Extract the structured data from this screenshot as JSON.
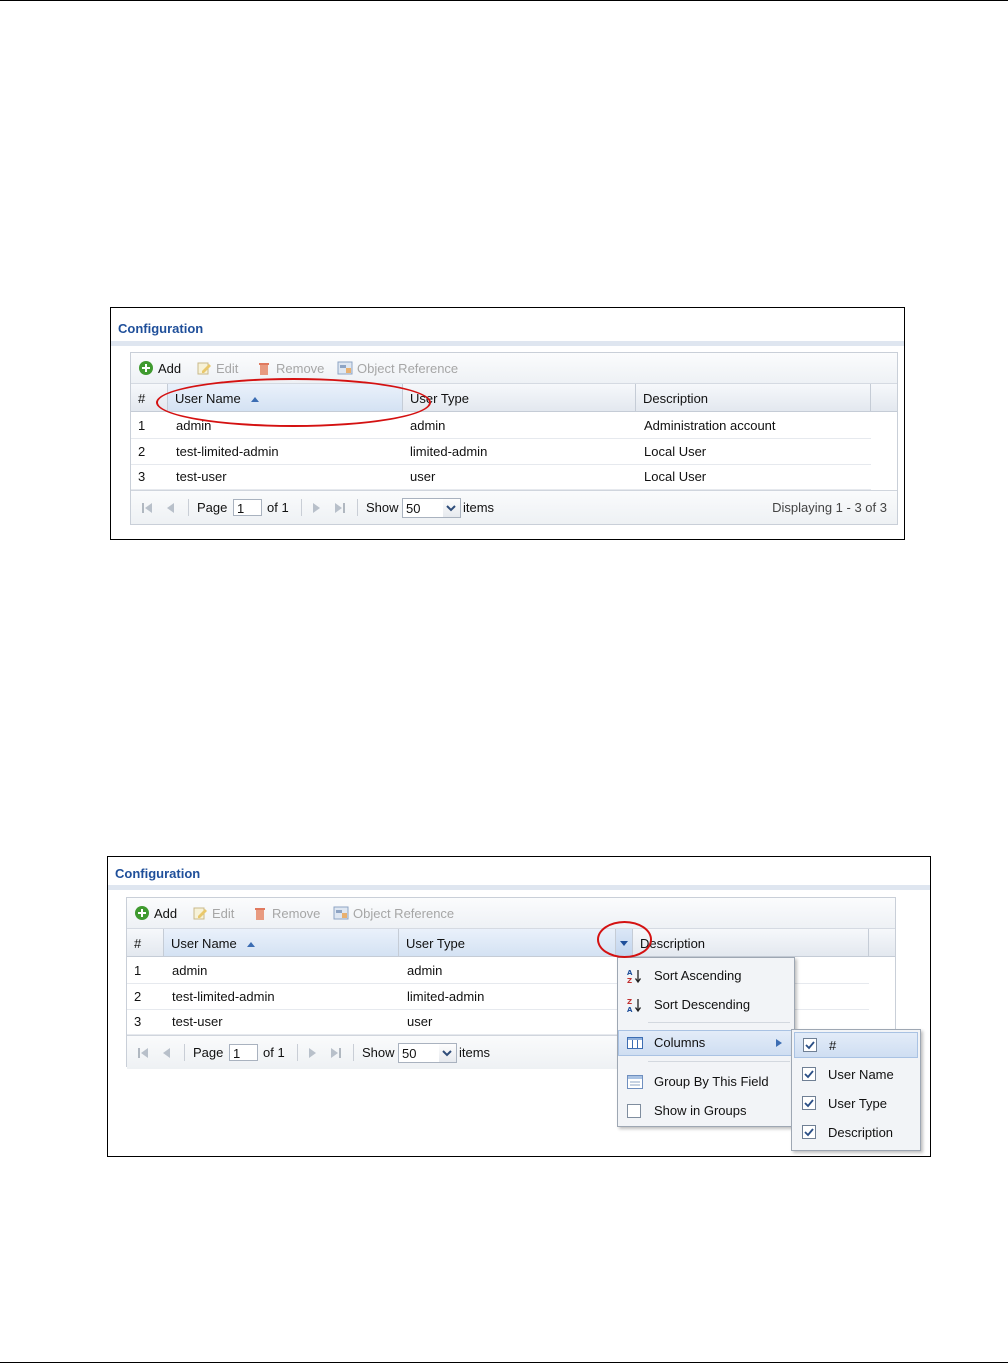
{
  "panel": {
    "title": "Configuration",
    "toolbar": {
      "add": "Add",
      "edit": "Edit",
      "remove": "Remove",
      "object_reference": "Object Reference"
    },
    "columns": {
      "num": "#",
      "user_name": "User Name",
      "user_type": "User Type",
      "description": "Description"
    },
    "rows": [
      {
        "num": "1",
        "user_name": "admin",
        "user_type": "admin",
        "description": "Administration account"
      },
      {
        "num": "2",
        "user_name": "test-limited-admin",
        "user_type": "limited-admin",
        "description": "Local User"
      },
      {
        "num": "3",
        "user_name": "test-user",
        "user_type": "user",
        "description": "Local User"
      }
    ],
    "pager": {
      "page_label": "Page",
      "page_value": "1",
      "of_label": "of 1",
      "show_label": "Show",
      "show_value": "50",
      "items_label": "items",
      "displaying": "Displaying 1 - 3 of 3"
    }
  },
  "column_menu": {
    "sort_ascending": "Sort Ascending",
    "sort_descending": "Sort Descending",
    "columns": "Columns",
    "group_by": "Group By This Field",
    "show_in_groups": "Show in Groups",
    "submenu": [
      "#",
      "User Name",
      "User Type",
      "Description"
    ]
  },
  "colors": {
    "title": "#1f4f9a",
    "highlight": "#d41111"
  }
}
